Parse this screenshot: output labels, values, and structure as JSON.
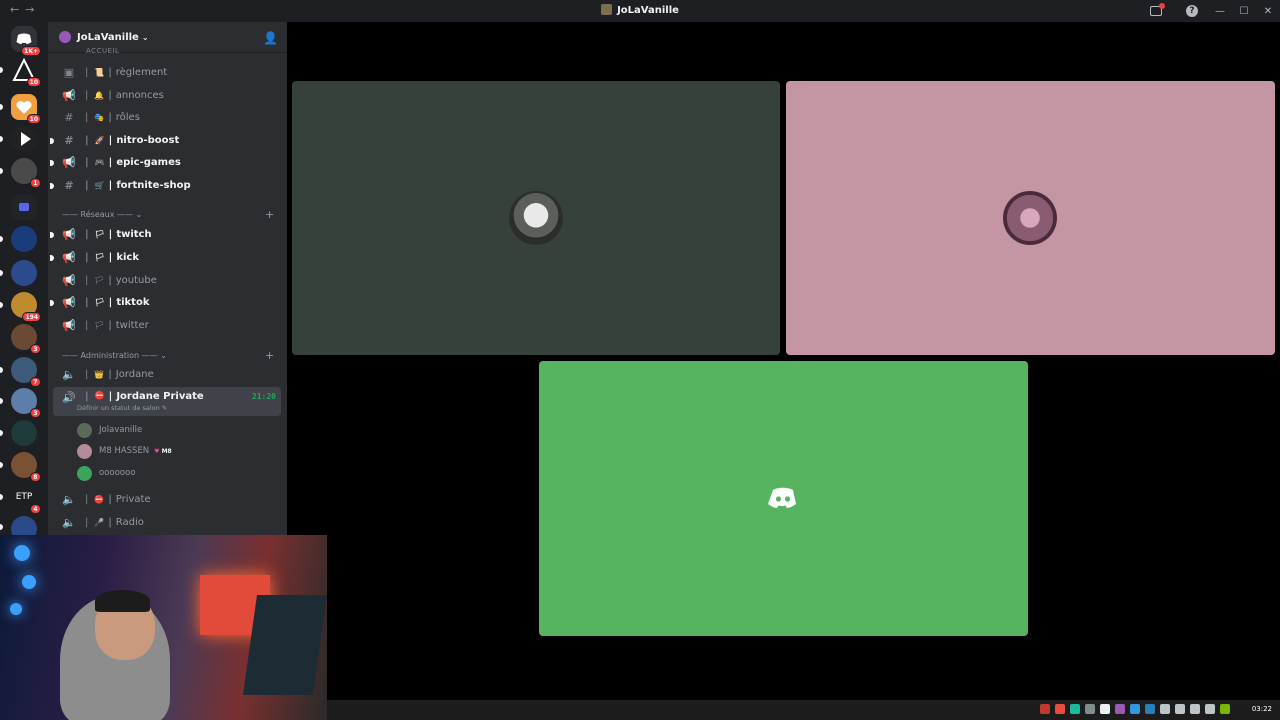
{
  "window": {
    "title": "JoLaVanille",
    "help_label": "?",
    "minimize": "—",
    "maximize": "☐",
    "close": "✕",
    "back": "←",
    "forward": "→"
  },
  "rail": {
    "servers": [
      {
        "name": "home",
        "badge": "1K+",
        "color": "#313338"
      },
      {
        "name": "server-a",
        "badge": "10",
        "color": "#2f2f2f"
      },
      {
        "name": "server-heart",
        "badge": "10",
        "color": "#f0a03c"
      },
      {
        "name": "server-starea",
        "badge": "",
        "color": "#222"
      },
      {
        "name": "server-dark",
        "badge": "1",
        "color": "#4a4a4a"
      },
      {
        "name": "folder",
        "badge": "",
        "color": "#3b3f8f"
      },
      {
        "name": "server-src",
        "badge": "",
        "color": "#1a3c7a"
      },
      {
        "name": "server-game",
        "badge": "",
        "color": "#2c4b8c"
      },
      {
        "name": "server-p",
        "badge": "194",
        "color": "#c08a2e"
      },
      {
        "name": "server-face",
        "badge": "3",
        "color": "#6b4a33"
      },
      {
        "name": "server-trophy",
        "badge": "7",
        "color": "#3d5a7a"
      },
      {
        "name": "server-person",
        "badge": "3",
        "color": "#5d7ea8"
      },
      {
        "name": "server-sword",
        "badge": "",
        "color": "#1e3a3a"
      },
      {
        "name": "server-group",
        "badge": "8",
        "color": "#7a5233"
      },
      {
        "name": "server-etp",
        "badge": "4",
        "label": "ETP",
        "color": "#1e1f22"
      },
      {
        "name": "server-y",
        "badge": "",
        "color": "#2a4a8a"
      }
    ]
  },
  "sidebar": {
    "server_name": "JoLaVanille",
    "clipped_category": "ACCUEIL",
    "channels_top": [
      {
        "name": "règlement",
        "emoji": "📜",
        "type": "rules",
        "unread": false
      },
      {
        "name": "annonces",
        "emoji": "🔔",
        "type": "announce",
        "unread": false
      },
      {
        "name": "rôles",
        "emoji": "🎭",
        "type": "text",
        "unread": false
      },
      {
        "name": "nitro-boost",
        "emoji": "🚀",
        "type": "text",
        "unread": true
      },
      {
        "name": "epic-games",
        "emoji": "🎮",
        "type": "announce",
        "unread": true
      },
      {
        "name": "fortnite-shop",
        "emoji": "🛒",
        "type": "text",
        "unread": true
      }
    ],
    "category_reseaux": "—— Réseaux ——",
    "channels_reseaux": [
      {
        "name": "twitch",
        "emoji": "🏳",
        "unread": true
      },
      {
        "name": "kick",
        "emoji": "🏳",
        "unread": true
      },
      {
        "name": "youtube",
        "emoji": "🏳",
        "unread": false
      },
      {
        "name": "tiktok",
        "emoji": "🏳",
        "unread": true
      },
      {
        "name": "twitter",
        "emoji": "🏳",
        "unread": false
      }
    ],
    "category_admin": "—— Administration ——",
    "voice_jordane": "Jordane",
    "active_voice": {
      "name": "Jordane Private",
      "timer": "21:20",
      "status": "Définir un statut de salon"
    },
    "voice_users": [
      {
        "name": "Jolavanille",
        "color": "#5b6b5b"
      },
      {
        "name": "M8 HASSEN",
        "tag": "M8",
        "color": "#b58a9a"
      },
      {
        "name": "ooooooo",
        "color": "#3ba55c"
      }
    ],
    "voice_private": "Private",
    "voice_radio": "Radio"
  },
  "stage": {
    "tiles": [
      {
        "name": "tile-jolavanille",
        "bg": "#364239",
        "avatar": "#c9c9c9"
      },
      {
        "name": "tile-m8-hassen",
        "bg": "#c496a3",
        "avatar": "#8a5c72"
      },
      {
        "name": "tile-ooooooo",
        "bg": "#56b35f"
      }
    ]
  },
  "taskbar": {
    "clock": "03:22"
  }
}
